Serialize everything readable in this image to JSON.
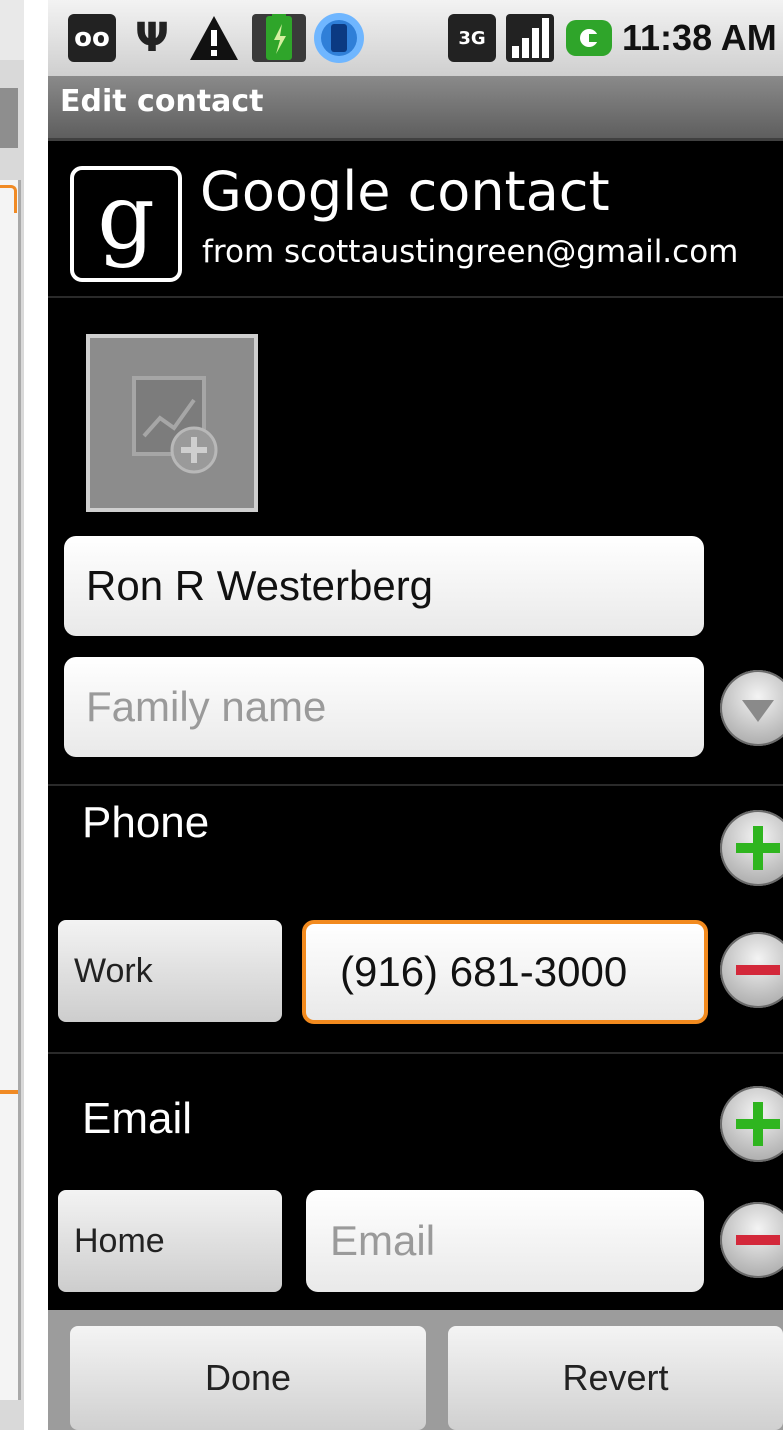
{
  "status_bar": {
    "time": "11:38 AM",
    "voicemail_text": "oo",
    "network_text": "3G",
    "icons": [
      "voicemail-icon",
      "usb-icon",
      "warning-icon",
      "battery-icon",
      "sync-icon",
      "3g-icon",
      "signal-icon",
      "gtalk-icon"
    ]
  },
  "title_bar": {
    "title": "Edit contact"
  },
  "account": {
    "logo_letter": "g",
    "title": "Google contact",
    "subtitle": "from scottaustingreen@gmail.com"
  },
  "name": {
    "given_value": "Ron R Westerberg",
    "family_placeholder": "Family name"
  },
  "phone": {
    "label": "Phone",
    "type": "Work",
    "value": "(916) 681-3000"
  },
  "email": {
    "label": "Email",
    "type": "Home",
    "placeholder": "Email"
  },
  "buttons": {
    "done": "Done",
    "revert": "Revert"
  },
  "colors": {
    "focus_orange": "#f28a1e",
    "add_green": "#2fb51f",
    "remove_red": "#d3283a"
  }
}
